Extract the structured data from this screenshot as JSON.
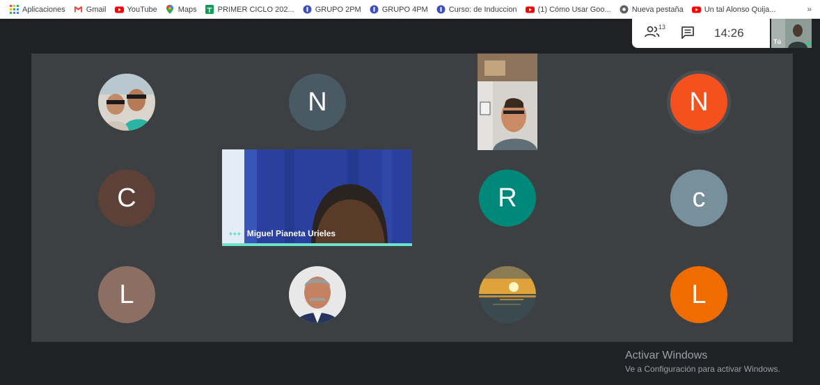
{
  "bookmarks": [
    {
      "label": "Aplicaciones",
      "icon": "apps-grid-icon"
    },
    {
      "label": "Gmail",
      "icon": "gmail-icon"
    },
    {
      "label": "YouTube",
      "icon": "youtube-icon"
    },
    {
      "label": "Maps",
      "icon": "maps-pin-icon"
    },
    {
      "label": "PRIMER CICLO 202...",
      "icon": "sheets-icon"
    },
    {
      "label": "GRUPO 2PM",
      "icon": "globe-icon"
    },
    {
      "label": "GRUPO 4PM",
      "icon": "globe-icon"
    },
    {
      "label": "Curso: de Induccion",
      "icon": "globe-icon"
    },
    {
      "label": "(1) Cómo Usar Goo...",
      "icon": "youtube-icon"
    },
    {
      "label": "Nueva pestaña",
      "icon": "chrome-icon"
    },
    {
      "label": "Un tal Alonso Quija...",
      "icon": "youtube-icon"
    }
  ],
  "bookmarks_more": "»",
  "meet": {
    "participant_count": "13",
    "time": "14:26",
    "self_label": "Tú",
    "featured_name": "Miguel Pianeta Urieles",
    "activation_title": "Activar Windows",
    "activation_subtitle": "Ve a Configuración para activar Windows."
  },
  "participants": [
    {
      "initial": "",
      "color": "#8f8f8f",
      "type": "photo-couple"
    },
    {
      "initial": "N",
      "color": "#4a5a64",
      "type": "letter"
    },
    {
      "initial": "",
      "color": "#b08a60",
      "type": "video"
    },
    {
      "initial": "N",
      "color": "#f4511e",
      "type": "letter"
    },
    {
      "initial": "C",
      "color": "#5d4037",
      "type": "letter"
    },
    {
      "initial": "R",
      "color": "#00897b",
      "type": "letter"
    },
    {
      "initial": "c",
      "color": "#78909c",
      "type": "letter"
    },
    {
      "initial": "L",
      "color": "#8d6e63",
      "type": "letter"
    },
    {
      "initial": "",
      "color": "#c9c9c9",
      "type": "photo-man"
    },
    {
      "initial": "",
      "color": "#d78a2a",
      "type": "photo-sunset"
    },
    {
      "initial": "L",
      "color": "#ef6c00",
      "type": "letter"
    }
  ],
  "colors": {
    "background": "#202124",
    "grid": "#3c4043",
    "accent": "#6fe3c9"
  }
}
